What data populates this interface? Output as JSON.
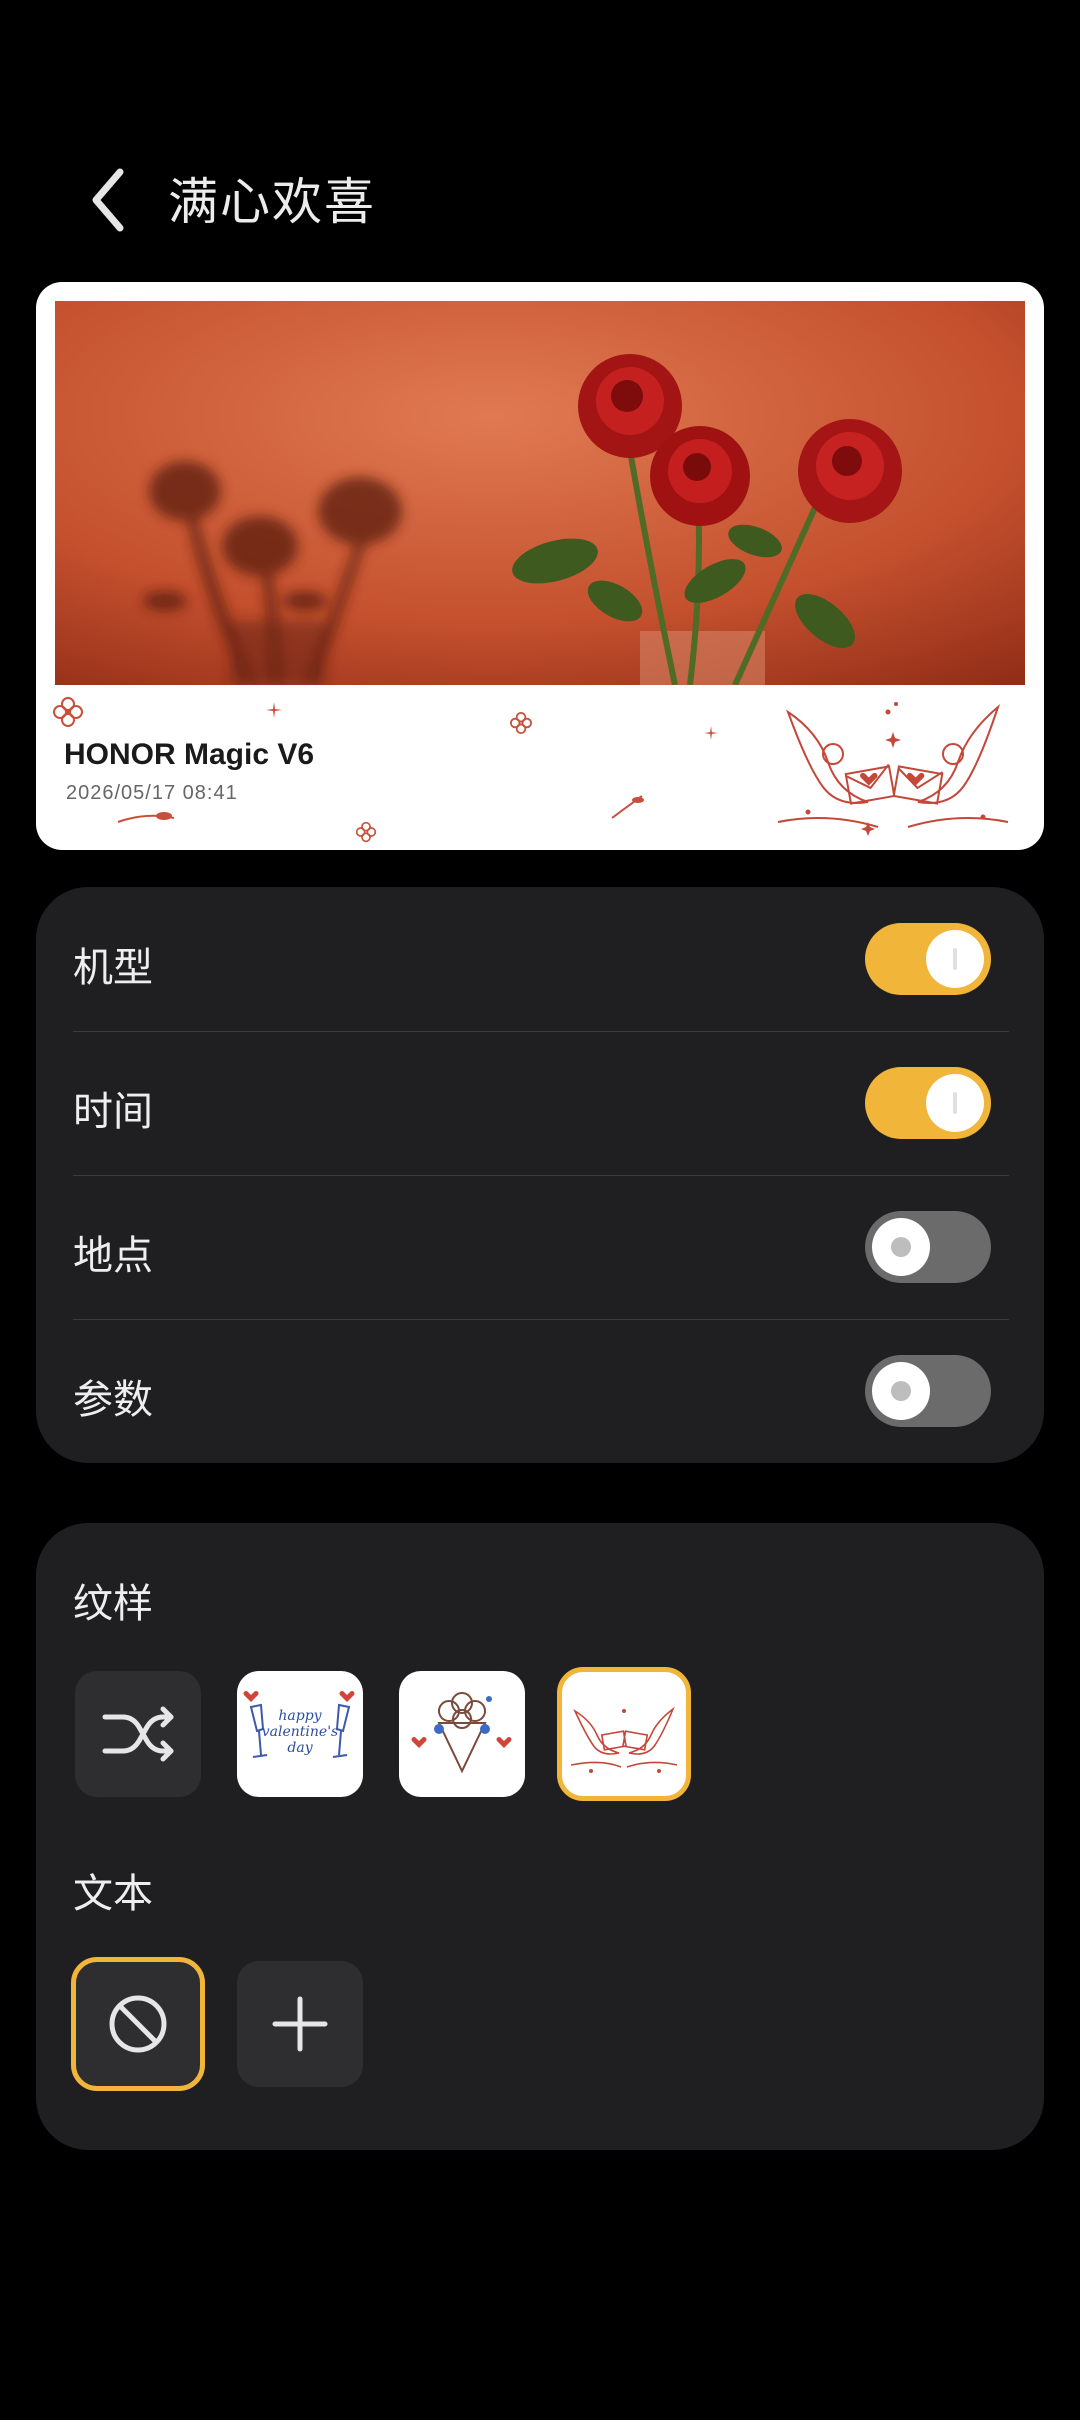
{
  "header": {
    "title": "满心欢喜",
    "back_icon": "chevron-left-icon"
  },
  "preview": {
    "device_name": "HONOR Magic V6",
    "timestamp": "2026/05/17 08:41",
    "photo_subject": "red roses in glass vase with shadow on orange wall",
    "sticker": "doves-with-letters"
  },
  "toggles": [
    {
      "label": "机型",
      "on": true
    },
    {
      "label": "时间",
      "on": true
    },
    {
      "label": "地点",
      "on": false
    },
    {
      "label": "参数",
      "on": false
    }
  ],
  "pattern_section": {
    "title": "纹样",
    "options": [
      {
        "name": "shuffle",
        "icon": "shuffle-icon",
        "selected": false
      },
      {
        "name": "happy valentine's day",
        "text_lines": [
          "happy",
          "valentine's",
          "day"
        ],
        "selected": false
      },
      {
        "name": "flower bouquet",
        "selected": false
      },
      {
        "name": "doves with letters",
        "selected": true
      }
    ]
  },
  "text_section": {
    "title": "文本",
    "options": [
      {
        "name": "none",
        "icon": "no-entry-icon",
        "selected": true
      },
      {
        "name": "add",
        "icon": "plus-icon",
        "selected": false
      }
    ]
  },
  "colors": {
    "accent": "#f1b53a",
    "panel": "#1f1f21",
    "background": "#000000",
    "switch_off": "#6b6b6b"
  }
}
